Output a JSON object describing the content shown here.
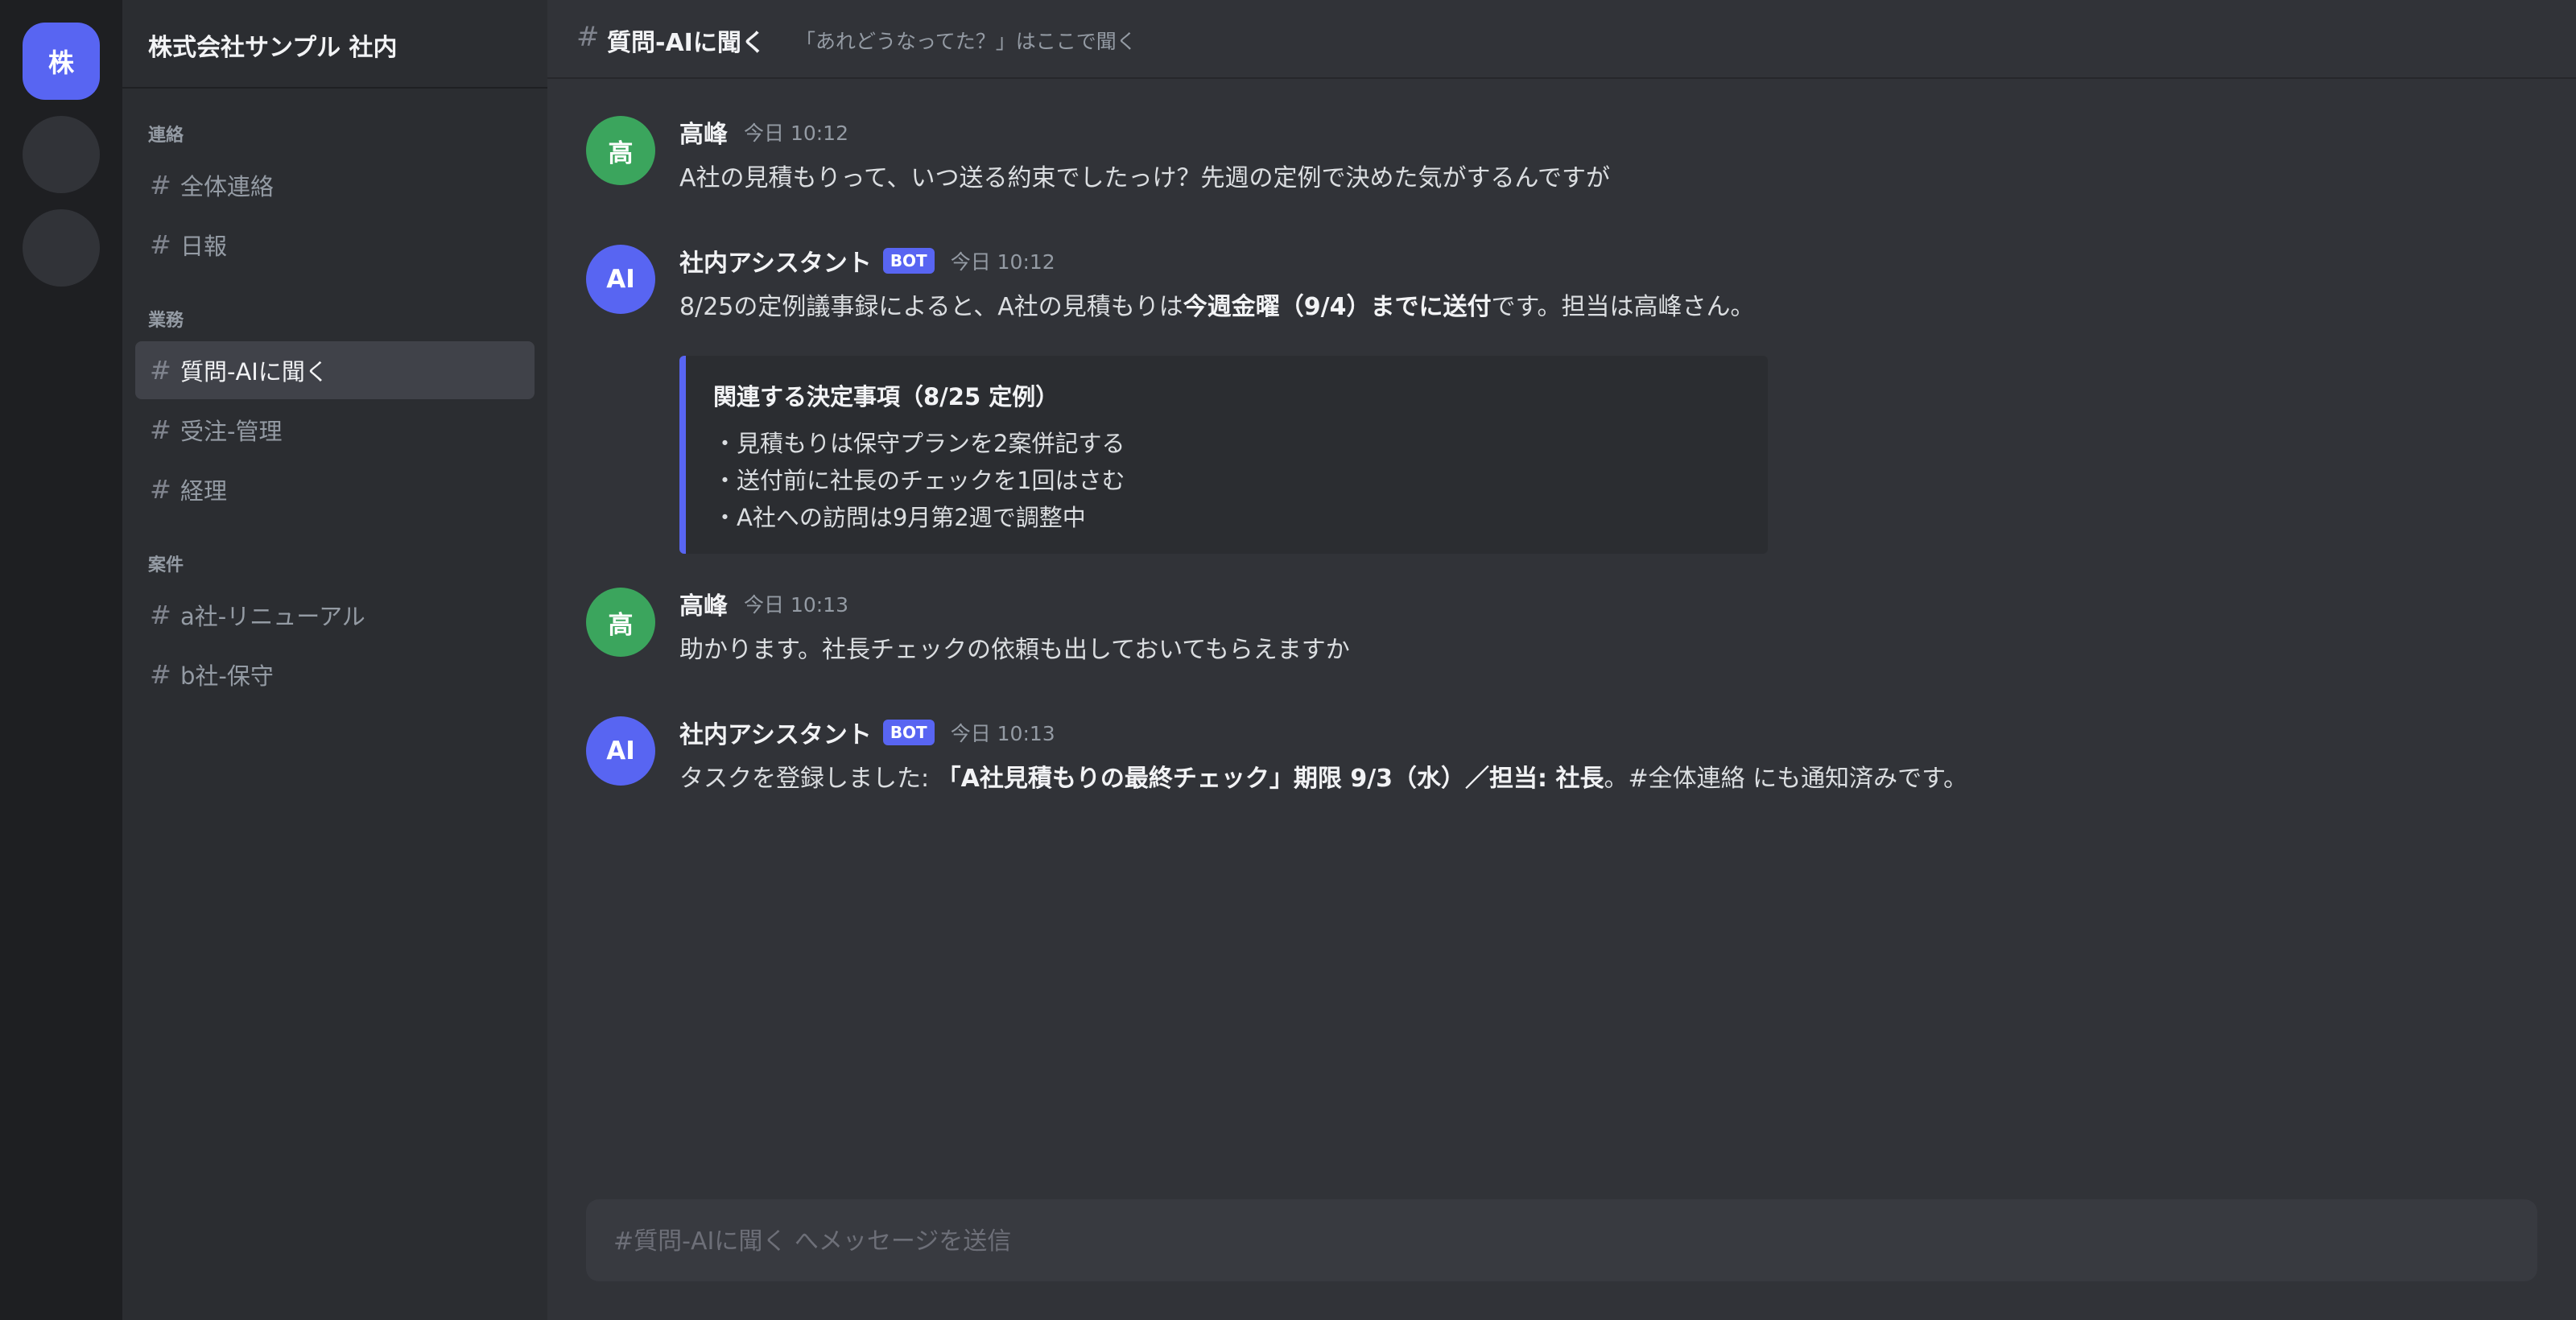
{
  "server_rail": {
    "active_label": "株"
  },
  "sidebar": {
    "guild_name": "株式会社サンプル 社内",
    "categories": [
      {
        "label": "連絡",
        "channels": [
          "全体連絡",
          "日報"
        ]
      },
      {
        "label": "業務",
        "channels": [
          "質問-AIに聞く",
          "受注-管理",
          "経理"
        ]
      },
      {
        "label": "案件",
        "channels": [
          "a社-リニューアル",
          "b社-保守"
        ]
      }
    ],
    "channel_hash": "#",
    "active_channel": "質問-AIに聞く"
  },
  "topbar": {
    "hash": "#",
    "title": "質問-AIに聞く",
    "topic": "「あれどうなってた？」はここで聞く"
  },
  "messages": [
    {
      "avatar": "高",
      "author": "高峰",
      "time": "今日 10:12",
      "text": "A社の見積もりって、いつ送る約束でしたっけ？先週の定例で決めた気がするんですが"
    },
    {
      "avatar": "AI",
      "author": "社内アシスタント",
      "bot_badge": "BOT",
      "time": "今日 10:12",
      "text_pre": "8/25の定例議事録によると、A社の見積もりは",
      "text_bold": "今週金曜（9/4）までに送付",
      "text_post": "です。担当は高峰さん。",
      "embed": {
        "title": "関連する決定事項（8/25 定例）",
        "lines": [
          "・見積もりは保守プランを2案併記する",
          "・送付前に社長のチェックを1回はさむ",
          "・A社への訪問は9月第2週で調整中"
        ]
      }
    },
    {
      "avatar": "高",
      "author": "高峰",
      "time": "今日 10:13",
      "text": "助かります。社長チェックの依頼も出しておいてもらえますか"
    },
    {
      "avatar": "AI",
      "author": "社内アシスタント",
      "bot_badge": "BOT",
      "time": "今日 10:13",
      "text_pre": "タスクを登録しました: ",
      "text_bold": "「A社見積もりの最終チェック」期限 9/3（水）／担当: 社長",
      "text_post": "。#全体連絡 にも通知済みです。"
    }
  ],
  "composer": {
    "placeholder": "#質問-AIに聞く へメッセージを送信"
  },
  "colors": {
    "accent": "#5865f2",
    "avatar_human": "#3ba55d",
    "background": "#313338",
    "sidebar": "#2b2d31",
    "rail": "#1e1f22"
  }
}
